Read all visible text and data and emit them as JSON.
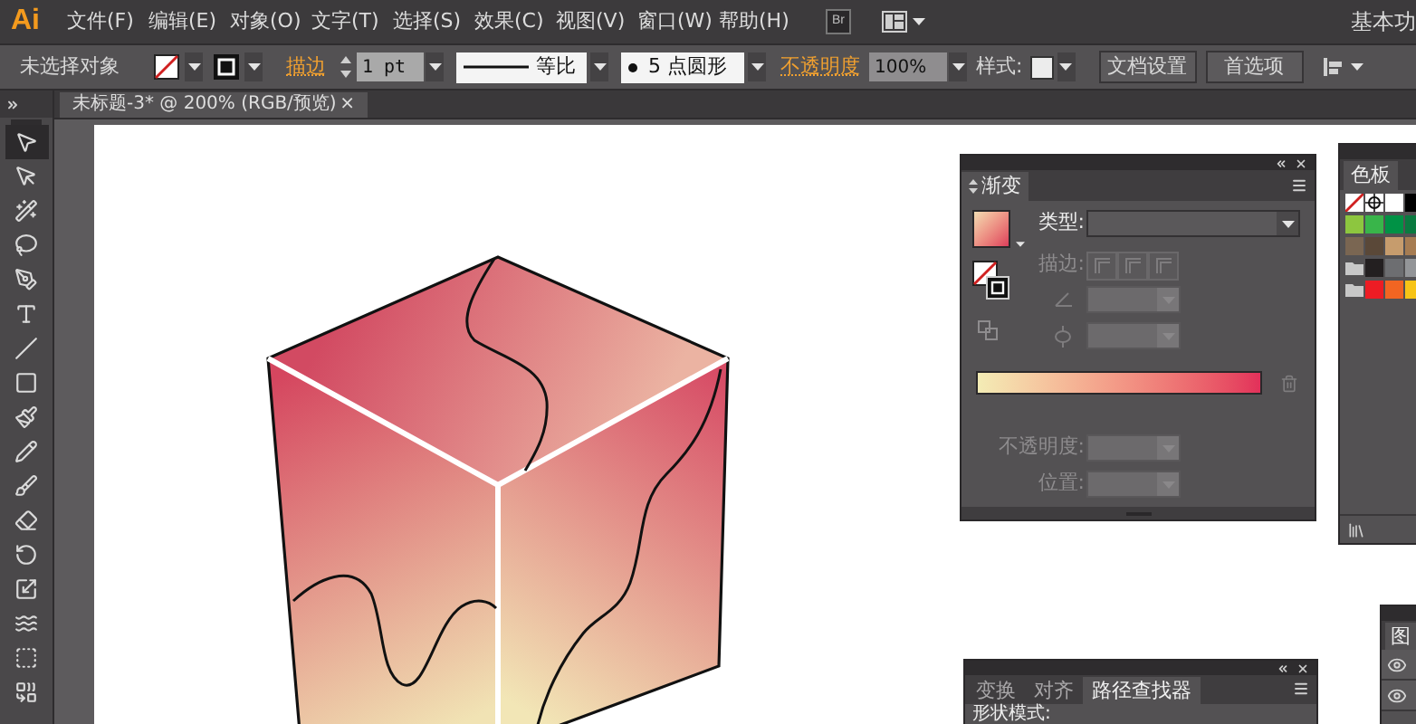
{
  "menu_bar": {
    "logo": "Ai",
    "items": [
      "文件(F)",
      "编辑(E)",
      "对象(O)",
      "文字(T)",
      "选择(S)",
      "效果(C)",
      "视图(V)",
      "窗口(W)",
      "帮助(H)"
    ],
    "bridge": "Br",
    "workspace": "基本功"
  },
  "control_bar": {
    "selection_status": "未选择对象",
    "stroke_label": "描边",
    "stroke_weight": "1 pt",
    "stroke_profile": "等比",
    "brush": "5 点圆形",
    "opacity_label": "不透明度",
    "opacity": "100%",
    "style_label": "样式:",
    "buttons": [
      "文档设置",
      "首选项"
    ]
  },
  "document_tab": {
    "title": "未标题-3* @ 200% (RGB/预览)",
    "close": "×"
  },
  "tools": [
    {
      "kind": "selection",
      "selected": true
    },
    {
      "kind": "direct_selection",
      "selected": false
    },
    {
      "kind": "magic_wand",
      "selected": false
    },
    {
      "kind": "lasso",
      "selected": false
    },
    {
      "kind": "pen",
      "selected": false
    },
    {
      "kind": "type",
      "selected": false
    },
    {
      "kind": "line",
      "selected": false
    },
    {
      "kind": "rectangle",
      "selected": false
    },
    {
      "kind": "paintbrush",
      "selected": false
    },
    {
      "kind": "pencil",
      "selected": false
    },
    {
      "kind": "blob_brush",
      "selected": false
    },
    {
      "kind": "eraser",
      "selected": false
    },
    {
      "kind": "rotate",
      "selected": false
    },
    {
      "kind": "scale",
      "selected": false
    },
    {
      "kind": "warp",
      "selected": false
    },
    {
      "kind": "free_transform",
      "selected": false
    },
    {
      "kind": "shape_builder",
      "selected": false
    }
  ],
  "gradient_panel": {
    "tab": "渐变",
    "type": {
      "label": "类型:",
      "disabled": false
    },
    "stroke": {
      "label": "描边:",
      "disabled": true
    },
    "angle": {
      "disabled": true
    },
    "aspect_ratio": {
      "disabled": true
    },
    "opacity": {
      "label": "不透明度:",
      "disabled": true
    },
    "location": {
      "label": "位置:",
      "disabled": true
    }
  },
  "swatches_panel": {
    "tab": "色板",
    "rows": [
      {
        "swatches": [
          {
            "kind": "none"
          },
          {
            "kind": "registration"
          },
          {
            "kind": "color",
            "color": "#ffffff"
          },
          {
            "kind": "color",
            "color": "#000000"
          }
        ]
      },
      {
        "swatches": [
          {
            "kind": "color",
            "color": "#8dc63f"
          },
          {
            "kind": "color",
            "color": "#39b54a"
          },
          {
            "kind": "color",
            "color": "#009245"
          },
          {
            "kind": "color",
            "color": "#0a7a40"
          }
        ]
      },
      {
        "swatches": [
          {
            "kind": "color",
            "color": "#7a6652"
          },
          {
            "kind": "color",
            "color": "#5a4838"
          },
          {
            "kind": "color",
            "color": "#c69c6d"
          },
          {
            "kind": "color",
            "color": "#a67c52"
          }
        ]
      },
      {
        "swatches": [
          {
            "kind": "folder"
          },
          {
            "kind": "color",
            "color": "#231f20"
          },
          {
            "kind": "color",
            "color": "#6d6e71"
          },
          {
            "kind": "color",
            "color": "#939598"
          }
        ]
      },
      {
        "swatches": [
          {
            "kind": "folder"
          },
          {
            "kind": "color",
            "color": "#ed1c24"
          },
          {
            "kind": "color",
            "color": "#f26522"
          },
          {
            "kind": "color",
            "color": "#f7c417"
          }
        ]
      }
    ]
  },
  "path_panel": {
    "tabs": [
      {
        "label": "变换",
        "selected": false
      },
      {
        "label": "对齐",
        "selected": false
      },
      {
        "label": "路径查找器",
        "selected": true
      }
    ],
    "section": "形状模式:"
  },
  "layers_panel": {
    "tab": "图",
    "rows": [
      {
        "visible": true
      },
      {
        "visible": true
      }
    ]
  }
}
